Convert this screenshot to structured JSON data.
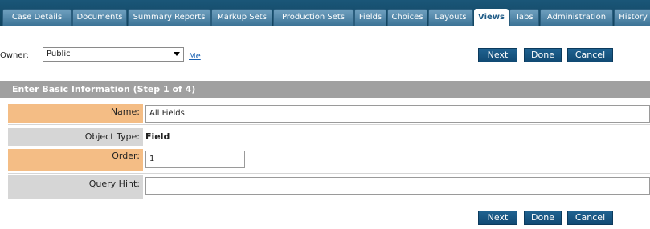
{
  "tabs": [
    {
      "label": "Case Details",
      "active": false
    },
    {
      "label": "Documents",
      "active": false
    },
    {
      "label": "Summary Reports",
      "active": false
    },
    {
      "label": "Markup Sets",
      "active": false
    },
    {
      "label": "Production Sets",
      "active": false
    },
    {
      "label": "Fields",
      "active": false
    },
    {
      "label": "Choices",
      "active": false
    },
    {
      "label": "Layouts",
      "active": false
    },
    {
      "label": "Views",
      "active": true
    },
    {
      "label": "Tabs",
      "active": false
    },
    {
      "label": "Administration",
      "active": false
    },
    {
      "label": "History",
      "active": false
    }
  ],
  "owner": {
    "label": "Owner:",
    "selected": "Public",
    "me_link": "Me"
  },
  "buttons": {
    "next": "Next",
    "done": "Done",
    "cancel": "Cancel"
  },
  "section": {
    "title": "Enter Basic Information (Step 1 of 4)"
  },
  "form": {
    "name": {
      "label": "Name:",
      "value": "All Fields"
    },
    "object_type": {
      "label": "Object Type:",
      "value": "Field"
    },
    "order": {
      "label": "Order:",
      "value": "1"
    },
    "query_hint": {
      "label": "Query Hint:",
      "value": ""
    }
  },
  "colors": {
    "tab_bar": "#124560",
    "button": "#1a5a87",
    "required_label": "#f4bd85",
    "optional_label": "#d6d6d6",
    "section_header": "#a0a0a0"
  }
}
